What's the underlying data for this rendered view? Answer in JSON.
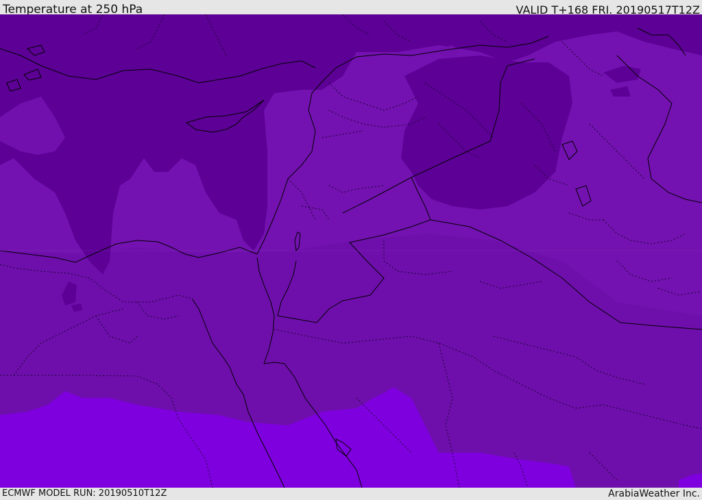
{
  "header": {
    "title": "Temperature at 250 hPa",
    "valid": "VALID T+168 FRI. 20190517T12Z"
  },
  "footer": {
    "model_run": "ECMWF MODEL RUN: 20190510T12Z",
    "credit": "ArabiaWeather Inc."
  },
  "map": {
    "field": "Temperature at 250 hPa",
    "colors": {
      "coldest": "#5d0096",
      "cold": "#7110ad",
      "mid": "#7312b0",
      "warm": "#6e0fab",
      "warmest": "#7f00df",
      "coastline": "#000000",
      "borders": "#1a0030"
    }
  }
}
